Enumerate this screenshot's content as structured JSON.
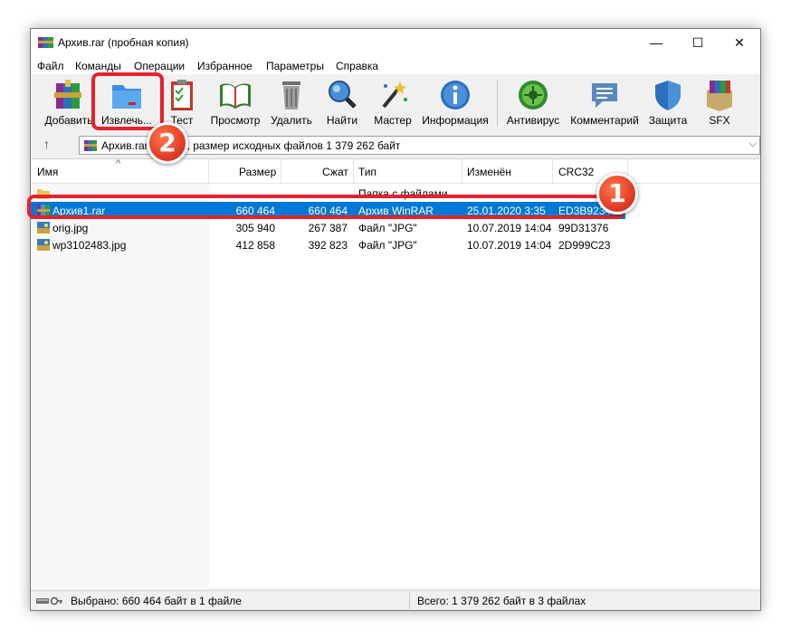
{
  "window": {
    "title": "Архив.rar (пробная копия)",
    "minimize": "—",
    "maximize": "☐",
    "close": "✕"
  },
  "menu": [
    "Файл",
    "Команды",
    "Операции",
    "Избранное",
    "Параметры",
    "Справка"
  ],
  "toolbar": [
    "Добавить",
    "Извлечь...",
    "Тест",
    "Просмотр",
    "Удалить",
    "Найти",
    "Мастер",
    "Информация",
    "Антивирус",
    "Комментарий",
    "Защита",
    "SFX"
  ],
  "address": {
    "up": "↑",
    "text": "Архив.rar - архив, размер исходных файлов 1 379 262 байт",
    "dropdown": "⌵"
  },
  "columns": {
    "name": "Имя",
    "size": "Размер",
    "packed": "Сжат",
    "type": "Тип",
    "modified": "Изменён",
    "crc": "CRC32",
    "sort_arrow": "^"
  },
  "files": [
    {
      "name": "..",
      "size": "",
      "packed": "",
      "type": "Папка с файлами",
      "modified": "",
      "crc": ""
    },
    {
      "name": "Архив1.rar",
      "size": "660 464",
      "packed": "660 464",
      "type": "Архив WinRAR",
      "modified": "25.01.2020 3:35",
      "crc": "ED3B9234"
    },
    {
      "name": "orig.jpg",
      "size": "305 940",
      "packed": "267 387",
      "type": "Файл \"JPG\"",
      "modified": "10.07.2019 14:04",
      "crc": "99D31376"
    },
    {
      "name": "wp3102483.jpg",
      "size": "412 858",
      "packed": "392 823",
      "type": "Файл \"JPG\"",
      "modified": "10.07.2019 14:04",
      "crc": "2D999C23"
    }
  ],
  "status": {
    "selected": "Выбрано: 660 464 байт в 1 файле",
    "total": "Всего: 1 379 262 байт в 3 файлах"
  },
  "annotations": {
    "badge1": "1",
    "badge2": "2"
  },
  "colors": {
    "selection": "#0078d7",
    "highlight": "#e8202a"
  }
}
